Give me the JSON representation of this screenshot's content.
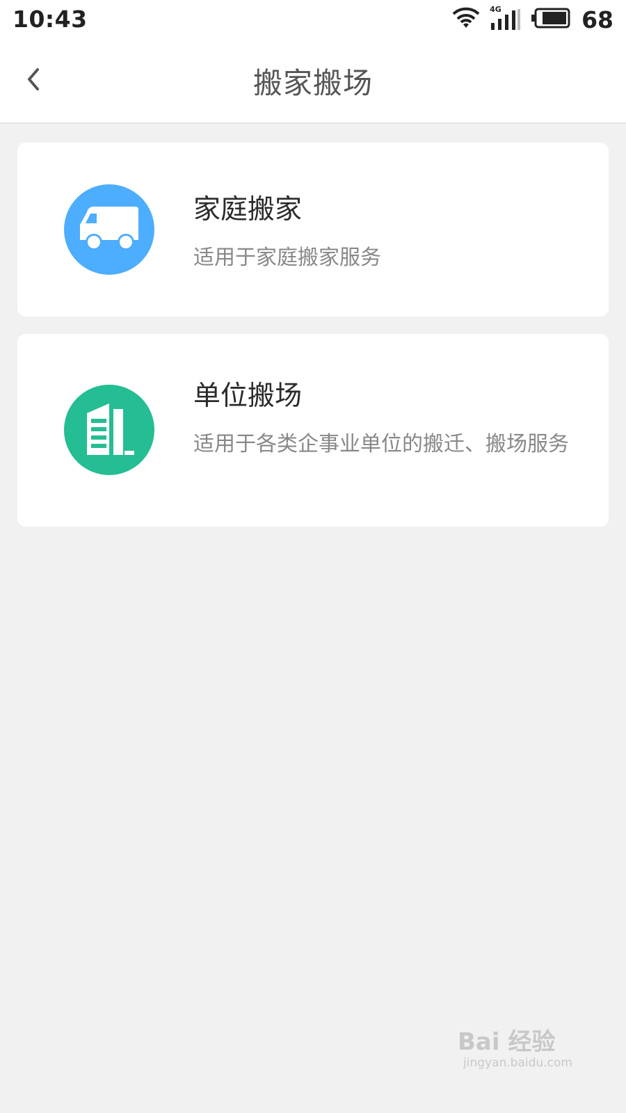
{
  "status_bar": {
    "time": "10:43",
    "network": "4G",
    "battery": "68",
    "icons": [
      "wifi-icon",
      "signal-icon",
      "battery-icon"
    ]
  },
  "header": {
    "title": "搬家搬场",
    "back_icon": "chevron-left-icon"
  },
  "services": [
    {
      "title": "家庭搬家",
      "description": "适用于家庭搬家服务",
      "icon": "truck-icon",
      "color": "#4dadfe"
    },
    {
      "title": "单位搬场",
      "description": "适用于各类企事业单位的搬迁、搬场服务",
      "icon": "building-icon",
      "color": "#25bd93"
    }
  ],
  "watermark": {
    "brand": "Bai 经验",
    "url": "jingyan.baidu.com"
  }
}
